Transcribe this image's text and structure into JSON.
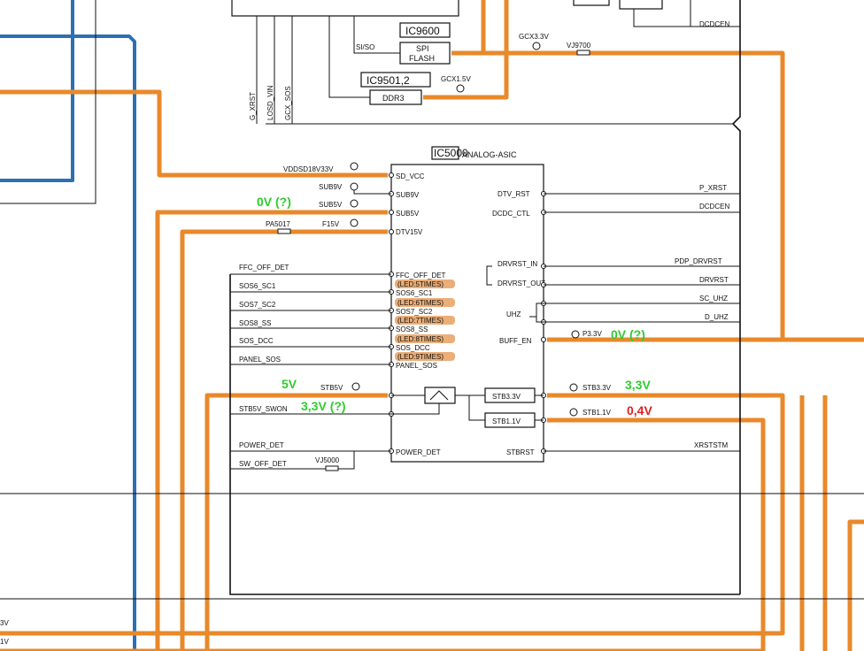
{
  "chips": {
    "spi_flash_id": "IC9600",
    "spi_flash_name": "SPI\nFLASH",
    "ddr_id": "IC9501,2",
    "ddr_name": "DDR3",
    "asic_id": "IC5000",
    "asic_name": "ANALOG-ASIC",
    "stb33_box": "STB3.3V",
    "stb11_box": "STB1.1V"
  },
  "top_pins": [
    "G_XRST",
    "LOSD_VIN",
    "GCX_SOS"
  ],
  "top_misc": {
    "sisi": "SI/SO",
    "gcx33": "GCX3.3V",
    "gcx15": "GCX1.5V",
    "vj9700": "VJ9700",
    "dcdcen_top": "DCDCEN"
  },
  "asic_left_pins": [
    "SD_VCC",
    "SUB9V",
    "SUB5V",
    "DTV15V",
    "FFC_OFF_DET",
    "SOS6_SC1",
    "SOS7_SC2",
    "SOS8_SS",
    "SOS_DCC",
    "PANEL_SOS",
    "POWER_DET"
  ],
  "asic_right_pins": [
    "DTV_RST",
    "DCDC_CTL",
    "DRVRST_IN",
    "DRVRST_OUT",
    "UHZ",
    "BUFF_EN",
    "STBRST"
  ],
  "led_tags": [
    "(LED:5TIMES)",
    "(LED:6TIMES)",
    "(LED:7TIMES)",
    "(LED:8TIMES)",
    "(LED:9TIMES)"
  ],
  "left_nets": {
    "vddsd": "VDDSD18V33V",
    "sub9v": "SUB9V",
    "sub5v": "SUB5V",
    "pa5017": "PA5017",
    "f15v": "F15V",
    "ffc": "FFC_OFF_DET",
    "sos6": "SOS6_SC1",
    "sos7": "SOS7_SC2",
    "sos8": "SOS8_SS",
    "sosdcc": "SOS_DCC",
    "panel": "PANEL_SOS",
    "stb5v": "STB5V",
    "stb5v_swon": "STB5V_SWON",
    "power_det": "POWER_DET",
    "sw_off_det": "SW_OFF_DET",
    "vj5000": "VJ5000"
  },
  "right_nets": {
    "p_xrst": "P_XRST",
    "dcdcen": "DCDCEN",
    "pdp_drvrst": "PDP_DRVRST",
    "drvrst": "DRVRST",
    "sc_uhz": "SC_UHZ",
    "d_uhz": "D_UHZ",
    "p33v": "P3.3V",
    "stb33v": "STB3.3V",
    "stb11v": "STB1.1V",
    "xrststm": "XRSTSTM"
  },
  "edge_labels": [
    "3V",
    "1V"
  ],
  "annotations": {
    "sub5v_v": "0V (?)",
    "buff_en_v": "0V (?)",
    "stb5v_v": "5V",
    "swon_v": "3,3V (?)",
    "stb33_v": "3,3V",
    "stb11_v": "0,4V"
  },
  "colors": {
    "highlight": "#e8892a",
    "blue_trace": "#2d6fb3",
    "ann_green": "#2ecc2e",
    "ann_red": "#e02020"
  }
}
